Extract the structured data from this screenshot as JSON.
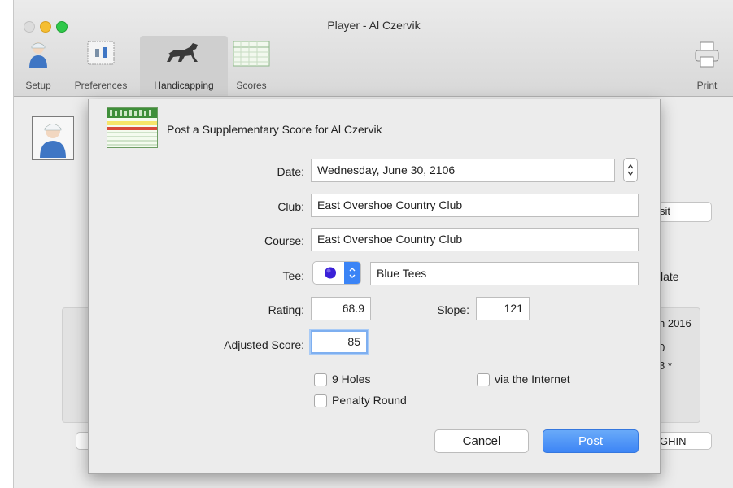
{
  "window": {
    "title": "Player - Al Czervik"
  },
  "toolbar": {
    "items": [
      {
        "label": "Setup",
        "icon": "person-icon"
      },
      {
        "label": "Preferences",
        "icon": "preferences-icon"
      },
      {
        "label": "Handicapping",
        "icon": "horse-icon",
        "active": true
      },
      {
        "label": "Scores",
        "icon": "scorecard-icon"
      }
    ],
    "print_label": "Print"
  },
  "background": {
    "button_visit": "sit",
    "text_late": "late",
    "panel_line1": "n 2016",
    "panel_line2": "0",
    "panel_line3": "8 *",
    "button_ghin": "GHIN"
  },
  "sheet": {
    "title": "Post a Supplementary Score for Al Czervik",
    "date_label": "Date:",
    "date_value": "Wednesday, June 30, 2106",
    "club_label": "Club:",
    "club_value": "East Overshoe Country Club",
    "course_label": "Course:",
    "course_value": "East Overshoe Country Club",
    "tee_label": "Tee:",
    "tee_value": "Blue Tees",
    "tee_color": "#3a20d8",
    "rating_label": "Rating:",
    "rating_value": "68.9",
    "slope_label": "Slope:",
    "slope_value": "121",
    "score_label": "Adjusted Score:",
    "score_value": "85",
    "nine_holes_label": "9 Holes",
    "internet_label": "via the Internet",
    "penalty_label": "Penalty Round",
    "cancel_label": "Cancel",
    "post_label": "Post"
  },
  "colors": {
    "accent": "#3d85f5",
    "focus_ring": "#7eaff0"
  }
}
